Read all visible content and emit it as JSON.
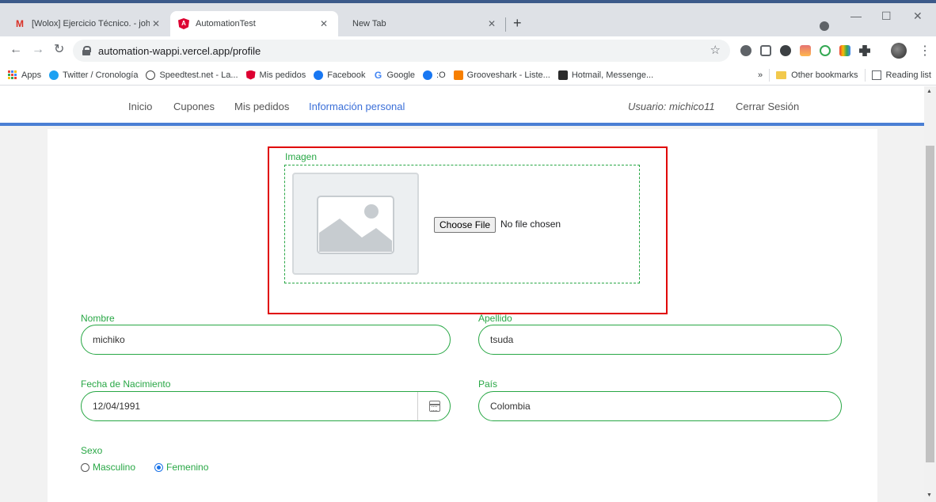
{
  "browser": {
    "tabs": [
      {
        "title": "[Wolox] Ejercicio Técnico. - johnd",
        "favicon": "gmail-icon",
        "active": false
      },
      {
        "title": "AutomationTest",
        "favicon": "angular-icon",
        "active": true
      },
      {
        "title": "New Tab",
        "favicon": "",
        "active": false
      }
    ],
    "new_tab": "+",
    "window": {
      "minimize": "—",
      "maximize": "☐",
      "close": "✕"
    },
    "url": "automation-wappi.vercel.app/profile",
    "bookmarks": [
      {
        "label": "Apps",
        "icon": "apps-grid-icon"
      },
      {
        "label": "Twitter / Cronología",
        "icon": "twitter-icon",
        "color": "#1da1f2"
      },
      {
        "label": "Speedtest.net - La...",
        "icon": "speedtest-icon",
        "color": "#444444"
      },
      {
        "label": "Mis pedidos",
        "icon": "angular-icon",
        "color": "#dd0031"
      },
      {
        "label": "Facebook",
        "icon": "facebook-icon",
        "color": "#1877f2"
      },
      {
        "label": "Google",
        "icon": "google-icon",
        "color": "#4285f4"
      },
      {
        "label": ":O",
        "icon": "facebook-icon",
        "color": "#1877f2"
      },
      {
        "label": "Grooveshark - Liste...",
        "icon": "grooveshark-icon",
        "color": "#f77f00"
      },
      {
        "label": "Hotmail, Messenge...",
        "icon": "msn-icon",
        "color": "#2b2b2b"
      }
    ],
    "bookmarks_more": "»",
    "other_bookmarks": "Other bookmarks",
    "reading_list": "Reading list"
  },
  "nav": {
    "links": [
      "Inicio",
      "Cupones",
      "Mis pedidos",
      "Información personal"
    ],
    "active_index": 3,
    "user": "Usuario: michico11",
    "logout": "Cerrar Sesión",
    "accent": "#3b6fd8"
  },
  "profile": {
    "image_label": "Imagen",
    "choose_file": "Choose File",
    "no_file": "No file chosen",
    "nombre_label": "Nombre",
    "nombre_value": "michiko",
    "apellido_label": "Apellido",
    "apellido_value": "tsuda",
    "fecha_label": "Fecha de Nacimiento",
    "fecha_value": "12/04/1991",
    "pais_label": "País",
    "pais_value": "Colombia",
    "sexo_label": "Sexo",
    "sexo_options": [
      "Masculino",
      "Femenino"
    ],
    "sexo_selected": "Femenino",
    "label_color": "#28a745",
    "highlight_color": "#e00000"
  }
}
